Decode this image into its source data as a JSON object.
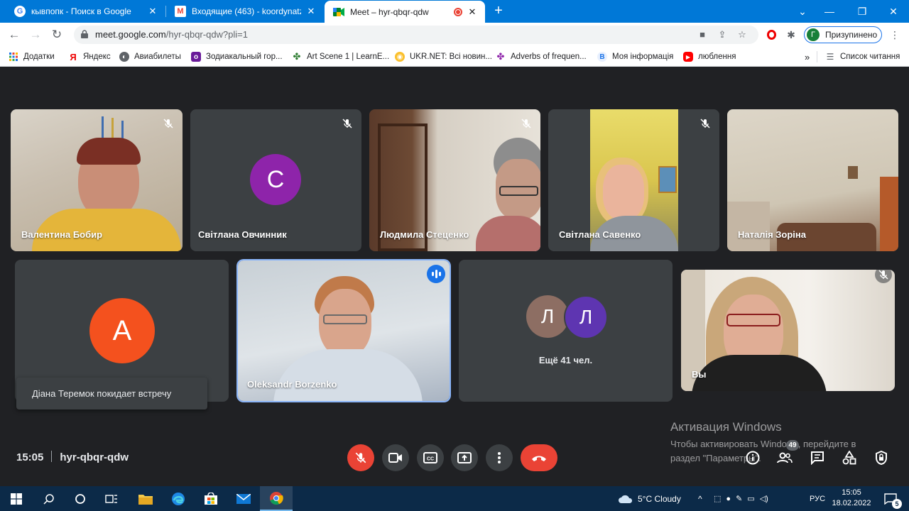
{
  "browser": {
    "tabs": [
      {
        "title": "кывпопк - Поиск в Google",
        "favicon": "google-icon",
        "close": "✕"
      },
      {
        "title": "Входящие (463) - koordynatzia@",
        "favicon": "gmail-icon",
        "close": "✕"
      },
      {
        "title": "Meet – hyr-qbqr-qdw",
        "favicon": "meet-icon",
        "close": "✕",
        "recording": true
      }
    ],
    "new_tab": "+",
    "url_host": "meet.google.com",
    "url_path": "/hyr-qbqr-qdw?pli=1",
    "profile_initial": "Г",
    "profile_label": "Призупинено",
    "bookmarks": [
      {
        "label": "Додатки",
        "icon": "apps-grid-icon"
      },
      {
        "label": "Яндекс",
        "icon": "yandex-icon"
      },
      {
        "label": "Авиабилеты",
        "icon": "globe-icon"
      },
      {
        "label": "Зодиакальный гор...",
        "icon": "zodiac-icon"
      },
      {
        "label": "Art Scene 1 | LearnE...",
        "icon": "clover-icon"
      },
      {
        "label": "UKR.NET: Всі новин...",
        "icon": "ukrnet-icon"
      },
      {
        "label": "Adverbs of frequen...",
        "icon": "clover-purple-icon"
      },
      {
        "label": "Моя інформація",
        "icon": "b-icon"
      },
      {
        "label": "люблення",
        "icon": "youtube-icon"
      }
    ],
    "overflow": "»",
    "reading_list": "Список читання"
  },
  "meet": {
    "participants_row1": [
      {
        "name": "Валентина Бобир",
        "type": "video",
        "muted": true
      },
      {
        "name": "Світлана Овчинник",
        "type": "avatar",
        "initial": "С",
        "avatar_color": "#8e24aa",
        "muted": true
      },
      {
        "name": "Людмила Стеценко",
        "type": "video",
        "muted": true
      },
      {
        "name": "Світлана Савенко",
        "type": "video",
        "muted": true
      },
      {
        "name": "Наталія Зоріна",
        "type": "video",
        "muted": false
      }
    ],
    "participants_row2": [
      {
        "name": "",
        "type": "avatar",
        "initial": "А",
        "avatar_color": "#f4511e",
        "muted": false
      },
      {
        "name": "Oleksandr Borzenko",
        "type": "video",
        "speaking": true
      },
      {
        "name": "",
        "type": "group",
        "initials": [
          "Л",
          "Л"
        ],
        "colors": [
          "#8d6e63",
          "#5e35b1"
        ],
        "more_label": "Ещё 41 чел."
      },
      {
        "name": "Вы",
        "type": "video",
        "muted": true
      }
    ],
    "toast": "Діана Теремок покидает встречу",
    "time": "15:05",
    "meeting_code": "hyr-qbqr-qdw",
    "participants_count": "49",
    "activation_title": "Активация Windows",
    "activation_line1": "Чтобы активировать Windows, перейдите в",
    "activation_line2": "раздел \"Параметры\"."
  },
  "taskbar": {
    "weather_temp": "5°C",
    "weather_text": "Cloudy",
    "language": "РУС",
    "time": "15:05",
    "date": "18.02.2022",
    "notification_count": "5"
  },
  "colors": {
    "chrome_blue": "#0078d7",
    "meet_bg": "#202124",
    "tile_bg": "#3c4043",
    "red": "#ea4335",
    "speaker_blue": "#1a73e8"
  }
}
